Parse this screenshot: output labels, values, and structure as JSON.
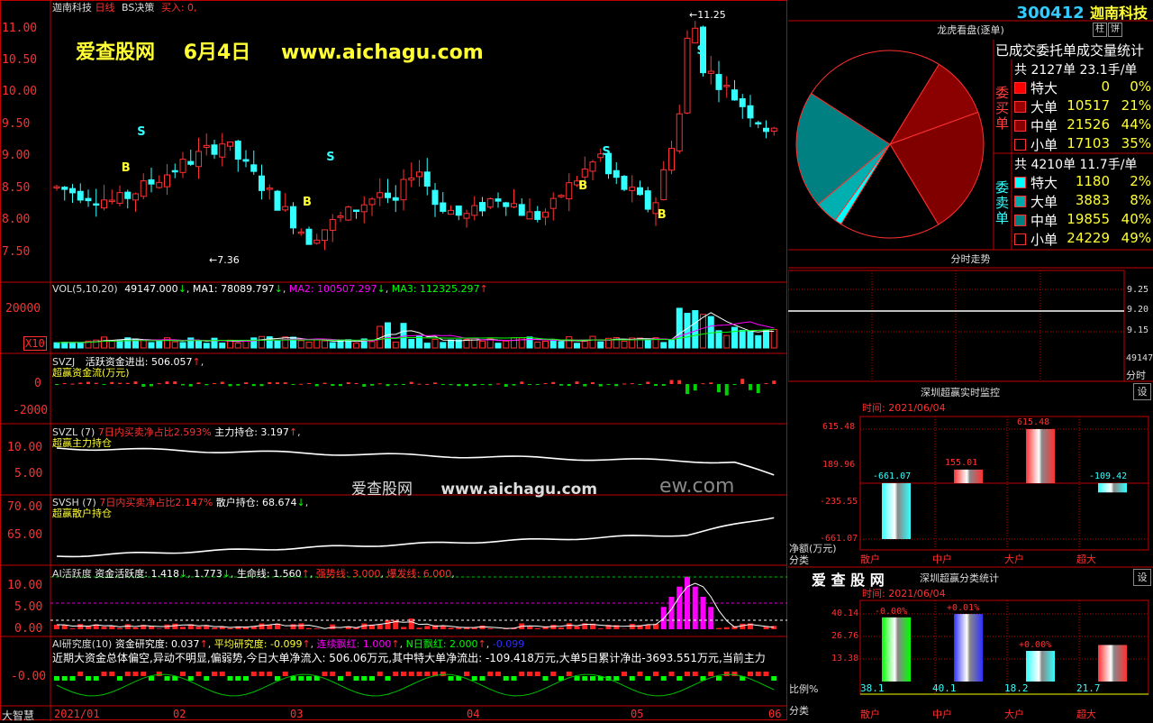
{
  "header": {
    "stock_name": "迦南科技",
    "period": "日线",
    "strategy": "BS决策",
    "buy_label": "买入: 0,",
    "code": "300412",
    "name": "迦南科技"
  },
  "watermark": {
    "site": "爱查股网",
    "date": "6月4日",
    "url": "www.aichagu.com",
    "mid_site": "爱查股网",
    "mid_url": "www.aichagu.com",
    "mid_tail": "ew.com"
  },
  "price_axis": [
    "11.00",
    "10.50",
    "10.00",
    "9.50",
    "9.00",
    "8.50",
    "8.00",
    "7.50"
  ],
  "price_notes": {
    "high": "11.25",
    "low": "7.36"
  },
  "vol": {
    "title": "VOL(5,10,20)",
    "v": "49147.000",
    "ma1": "MA1: 78089.797",
    "ma2": "MA2: 100507.297",
    "ma3": "MA3: 112325.297",
    "axis": [
      "20000"
    ],
    "unit": "X10"
  },
  "svzj": {
    "title": "SVZJ",
    "label": "活跃资金进出: 506.057",
    "subtitle": "超赢资金流(万元)",
    "axis": [
      "0",
      "-2000"
    ]
  },
  "svzl": {
    "title": "SVZL (7)",
    "ratio": "7日内买卖净占比2.593%",
    "hold": "主力持仓: 3.197",
    "subtitle": "超赢主力持仓",
    "axis": [
      "10.00",
      "5.00"
    ]
  },
  "svsh": {
    "title": "SVSH (7)",
    "ratio": "7日内买卖净占比2.147%",
    "hold": "散户持仓: 68.674",
    "subtitle": "超赢散户持仓",
    "axis": [
      "70.00",
      "65.00"
    ]
  },
  "ai_active": {
    "title": "AI活跃度",
    "a": "资金活跃度: 1.418",
    "b": "1.773",
    "c": "生命线: 1.560",
    "strong": "强势线: 3.000",
    "burst": "爆发线: 6.000",
    "axis": [
      "10.00",
      "5.00",
      "0.00"
    ]
  },
  "ai_research": {
    "title": "AI研究度(10)",
    "a": "资金研究度: 0.037",
    "b": "平均研究度: -0.099",
    "c": "连续飘红: 1.000",
    "d": "N日飘红: 2.000",
    "e": "-0.099",
    "text": "近期大资金总体偏空,异动不明显,偏弱势,今日大单净流入: 506.06万元,其中特大单净流出: -109.418万元,大单5日累计净出-3693.551万元,当前主力",
    "axis": [
      "-0.00"
    ]
  },
  "date_axis": [
    "2021/01",
    "02",
    "03",
    "04",
    "05",
    "06"
  ],
  "bottom_left": "大智慧",
  "panel_tiger": {
    "title": "龙虎看盘(逐单)",
    "subtitle": "已成交委托单成交量统计",
    "buy_label": "委买单",
    "sell_label": "委卖单",
    "buy_total": "共 2127单 23.1手/单",
    "sell_total": "共 4210单 11.7手/单",
    "buy_rows": [
      {
        "name": "特大",
        "v": "0",
        "p": "0%",
        "c": "#ff0000"
      },
      {
        "name": "大单",
        "v": "10517",
        "p": "21%",
        "c": "#990000"
      },
      {
        "name": "中单",
        "v": "21526",
        "p": "44%",
        "c": "#880000"
      },
      {
        "name": "小单",
        "v": "17103",
        "p": "35%",
        "c": "#000000"
      }
    ],
    "sell_rows": [
      {
        "name": "特大",
        "v": "1180",
        "p": "2%",
        "c": "#00ffff"
      },
      {
        "name": "大单",
        "v": "3883",
        "p": "8%",
        "c": "#00aaaa"
      },
      {
        "name": "中单",
        "v": "19855",
        "p": "40%",
        "c": "#008080"
      },
      {
        "name": "小单",
        "v": "24229",
        "p": "49%",
        "c": "#000000"
      }
    ],
    "btn_bar": "柱",
    "btn_pie": "饼"
  },
  "panel_intraday": {
    "title": "分时走势",
    "axis": [
      "9.25",
      "9.20",
      "9.15"
    ],
    "vol": "49147",
    "label": "分时"
  },
  "panel_monitor": {
    "title": "深圳超赢实时监控",
    "time": "时间: 2021/06/04",
    "btn": "设",
    "unit": "净额(万元)",
    "cls": "分类",
    "axis": [
      "615.48",
      "189.96",
      "-235.55",
      "-661.07"
    ],
    "cats": [
      "散户",
      "中户",
      "大户",
      "超大"
    ],
    "labels": [
      "-661.07",
      "155.01",
      "615.48",
      "-109.42"
    ]
  },
  "panel_stats": {
    "title": "深圳超赢分类统计",
    "brand": "爱 查 股 网",
    "time": "时间: 2021/06/04",
    "btn": "设",
    "unit": "比例%",
    "cls": "分类",
    "axis": [
      "40.14",
      "26.76",
      "13.38"
    ],
    "cats": [
      "散户",
      "中户",
      "大户",
      "超大"
    ],
    "top": [
      "-0.00%",
      "+0.01%",
      "+0.00%",
      ""
    ],
    "bottom": [
      "38.1",
      "40.1",
      "18.2",
      "21.7"
    ]
  },
  "chart_data": [
    {
      "type": "bar",
      "title": "深圳超赢实时监控",
      "categories": [
        "散户",
        "中户",
        "大户",
        "超大"
      ],
      "values": [
        -661.07,
        155.01,
        615.48,
        -109.42
      ],
      "ylabel": "净额(万元)",
      "ylim": [
        -661.07,
        615.48
      ]
    },
    {
      "type": "bar",
      "title": "深圳超赢分类统计",
      "categories": [
        "散户",
        "中户",
        "大户",
        "超大"
      ],
      "values": [
        38.1,
        40.1,
        18.2,
        21.7
      ],
      "ylabel": "比例%",
      "ylim": [
        0,
        40.14
      ]
    },
    {
      "type": "pie",
      "title": "龙虎看盘(逐单)",
      "categories": [
        "委买特大",
        "委买大单",
        "委买中单",
        "委买小单",
        "委卖特大",
        "委卖大单",
        "委卖中单",
        "委卖小单"
      ],
      "values": [
        0,
        10517,
        21526,
        17103,
        1180,
        3883,
        19855,
        24229
      ]
    }
  ]
}
